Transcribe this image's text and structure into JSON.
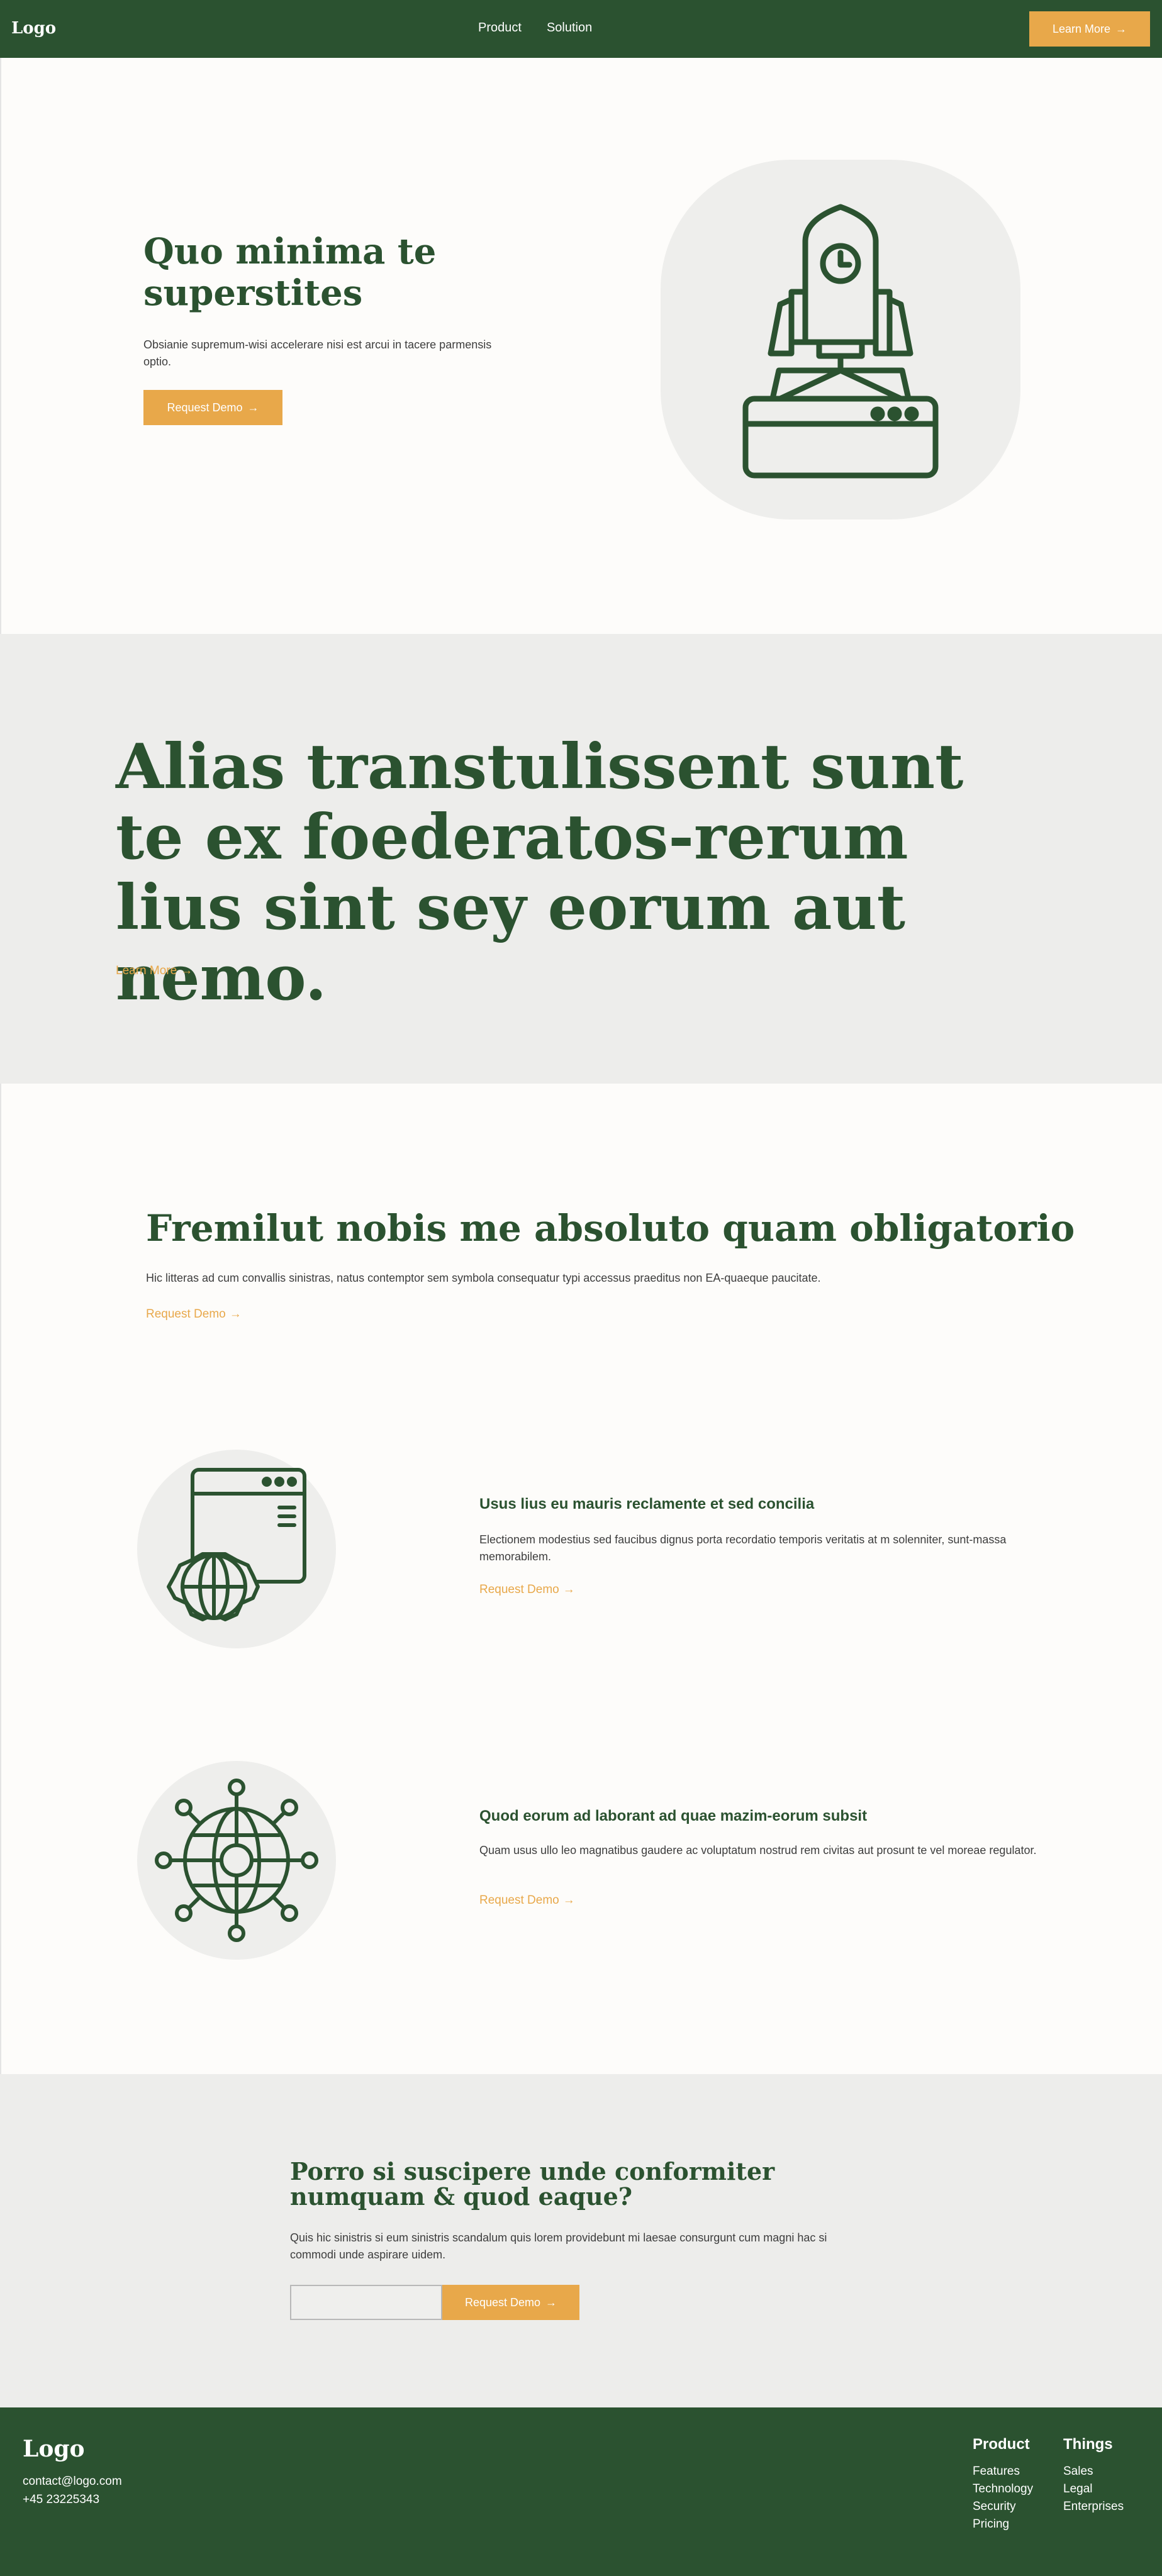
{
  "nav": {
    "logo": "Logo",
    "links": [
      "Product",
      "Solution"
    ],
    "cta_label": "Learn More",
    "cta_arrow": "→"
  },
  "hero": {
    "title": "Quo minima te superstites",
    "description": "Obsianie supremum-wisi accelerare nisi est arcui in tacere parmensis optio.",
    "button_label": "Request Demo",
    "button_arrow": "→",
    "illustration_icon": "rocket-launch-icon"
  },
  "statement": {
    "title": "Alias transtulissent sunt te ex foederatos-rerum lius sint sey eorum aut nemo.",
    "link_label": "Learn More",
    "link_arrow": "→"
  },
  "features": {
    "heading": "Fremilut nobis me absoluto quam obligatorio",
    "description": "Hic litteras ad cum convallis sinistras, natus contemptor sem symbola consequatur typi accessus praeditus non EA-quaeque paucitate.",
    "link_label": "Request Demo",
    "link_arrow": "→",
    "items": [
      {
        "icon": "browser-globe-gear-icon",
        "title": "Usus lius eu mauris reclamente et sed concilia",
        "description": "Electionem modestius sed faucibus dignus porta recordatio temporis veritatis at m solenniter, sunt-massa memorabilem.",
        "link_label": "Request Demo",
        "link_arrow": "→"
      },
      {
        "icon": "global-network-icon",
        "title": "Quod eorum ad laborant ad quae mazim-eorum subsit",
        "description": "Quam usus ullo leo magnatibus gaudere ac voluptatum nostrud rem civitas aut prosunt te vel moreae regulator.",
        "link_label": "Request Demo",
        "link_arrow": "→"
      }
    ]
  },
  "cta": {
    "title": "Porro si suscipere unde conformiter numquam & quod eaque?",
    "description": "Quis hic sinistris si eum sinistris scandalum quis lorem providebunt mi laesae consurgunt cum magni hac si commodi unde aspirare uidem.",
    "input_value": "",
    "button_label": "Request Demo",
    "button_arrow": "→"
  },
  "footer": {
    "logo": "Logo",
    "email": "contact@logo.com",
    "phone": "+45 23225343",
    "columns": [
      {
        "title": "Product",
        "links": [
          "Features",
          "Technology",
          "Security",
          "Pricing"
        ]
      },
      {
        "title": "Things",
        "links": [
          "Sales",
          "Legal",
          "Enterprises"
        ]
      }
    ]
  },
  "colors": {
    "brand_green": "#2b5230",
    "accent_orange": "#e8a84a",
    "section_gray": "#ededeb",
    "page_bg": "#fdfcfa"
  }
}
